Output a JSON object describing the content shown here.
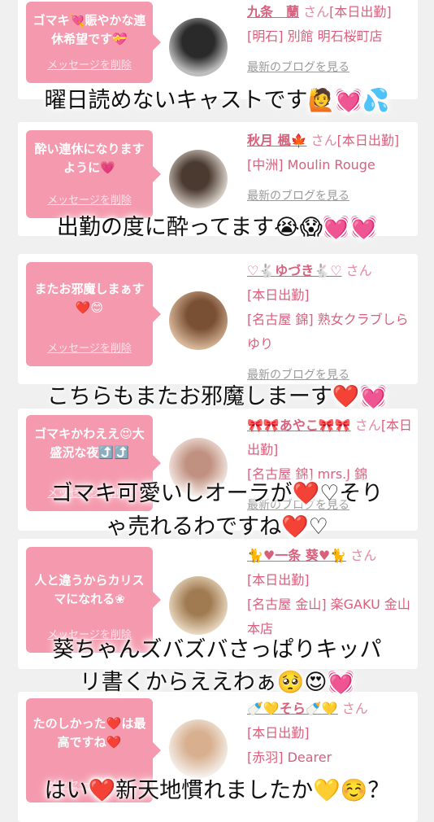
{
  "delete_label": "メッセージを削除",
  "san_label": "さん",
  "blog_link": "最新のブログを見る",
  "colors": {
    "accent": "#d9607d",
    "bubble": "#f59aae",
    "background": "#f0f0f0"
  },
  "cards": [
    {
      "message": "ゴマキ💘賑やかな連休希望です💝",
      "name": "九条　蘭",
      "status": "[本日出勤]",
      "location": "[明石] 別館 明石桜町店",
      "caption": "曜日読めないキャストです🙋💓💦"
    },
    {
      "message": "酔い連休になりますように💗",
      "name": "秋月 楓🍁",
      "status": "[本日出勤]",
      "location": "[中洲] Moulin Rouge",
      "caption": "出勤の度に酔ってます😭😱💓💓"
    },
    {
      "message": "またお邪魔しまぁす❤️😊",
      "name": "♡🐇ゆづき🐇♡",
      "status": "[本日出勤]",
      "location": "[名古屋 錦] 熟女クラブしらゆり",
      "caption": "こちらもまたお邪魔しまーす❤️💓"
    },
    {
      "message": "ゴマキかわええ😍大盛況な夜⤴️⤴️",
      "name": "🎀🎀あやこ🎀🎀",
      "status": "[本日出勤]",
      "location": "[名古屋 錦] mrs.J 錦",
      "caption_1": "ゴマキ可愛いしオーラが❤️♡そり",
      "caption_2": "ゃ売れるわですね❤️♡"
    },
    {
      "message": "人と違うからカリスマになれる❀",
      "name": "🐈♥一条 葵♥🐈",
      "status": "[本日出勤]",
      "location": "[名古屋 金山] 楽GAKU 金山本店",
      "caption_1": "葵ちゃんズバズバさっぱりキッパ",
      "caption_2": "リ書くからええわぁ🥺😍💓"
    },
    {
      "message": "たのしかった❤️は最高ですね❤️",
      "name": "🍼💛そら🍼💛",
      "status": "[本日出勤]",
      "location": "[赤羽] Dearer",
      "caption": "はい❤️新天地慣れましたか💛☺️？"
    }
  ]
}
